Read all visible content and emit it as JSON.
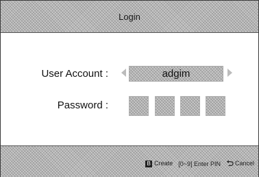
{
  "header": {
    "title": "Login"
  },
  "form": {
    "account_label": "User Account :",
    "account_value": "adgim",
    "password_label": "Password :",
    "pin_slots": 4
  },
  "footer": {
    "create_key": "B",
    "create_label": "Create",
    "pin_hint": "[0~9] Enter PIN",
    "cancel_label": "Cancel"
  }
}
